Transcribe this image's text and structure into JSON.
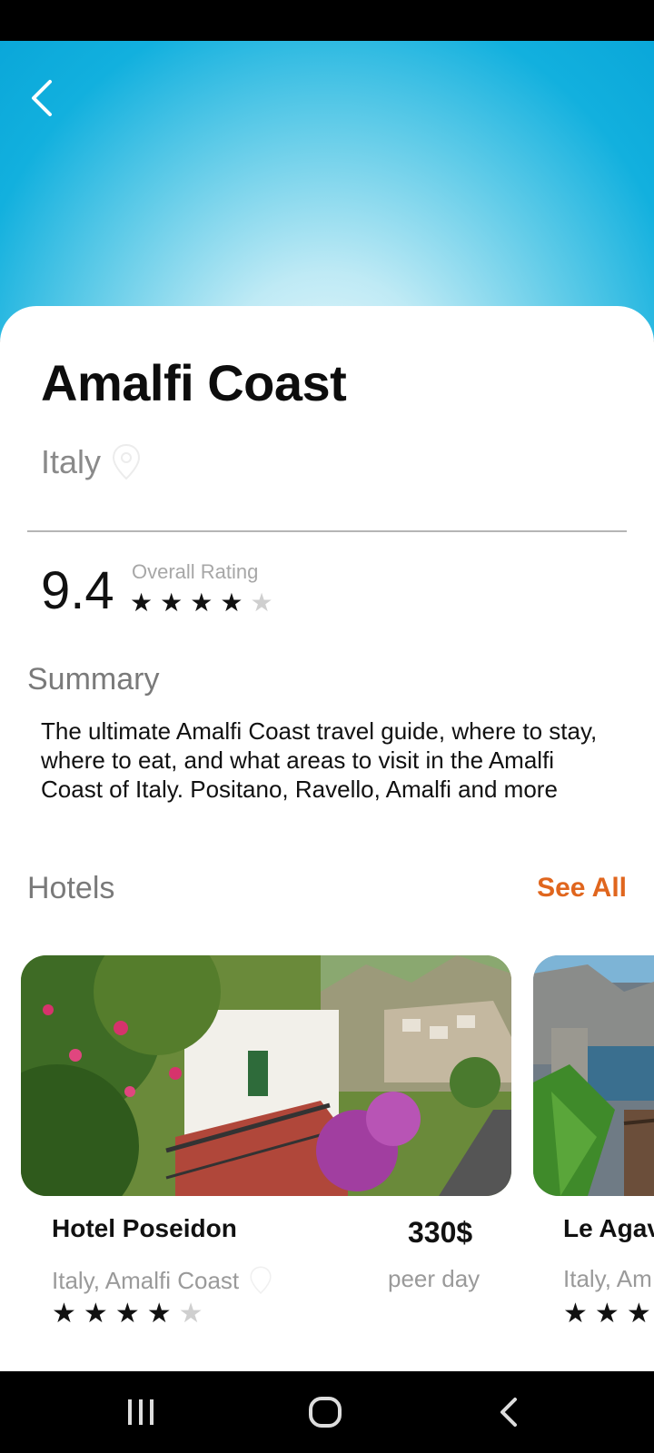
{
  "destination": {
    "title": "Amalfi Coast",
    "country": "Italy",
    "rating": "9.4",
    "rating_label": "Overall Rating",
    "stars": [
      "★",
      "★",
      "★",
      "★",
      "★"
    ]
  },
  "summary": {
    "heading": "Summary",
    "text": "The ultimate Amalfi Coast travel guide, where to stay, where to eat, and what areas to visit in the Amalfi Coast of Italy. Positano, Ravello, Amalfi and more"
  },
  "hotels": {
    "heading": "Hotels",
    "see_all": "See All",
    "items": [
      {
        "name": "Hotel Poseidon",
        "location": "Italy, Amalfi Coast",
        "price": "330$",
        "per": "peer day",
        "stars": [
          "★",
          "★",
          "★",
          "★",
          "★"
        ]
      },
      {
        "name": "Le Agav",
        "location": "Italy, Am",
        "stars": [
          "★",
          "★",
          "★"
        ]
      }
    ]
  },
  "colors": {
    "accent": "#e0661e",
    "sky": "#0aa7d9"
  },
  "icons": {
    "back": "chevron-left-icon",
    "pin": "location-pin-icon"
  }
}
